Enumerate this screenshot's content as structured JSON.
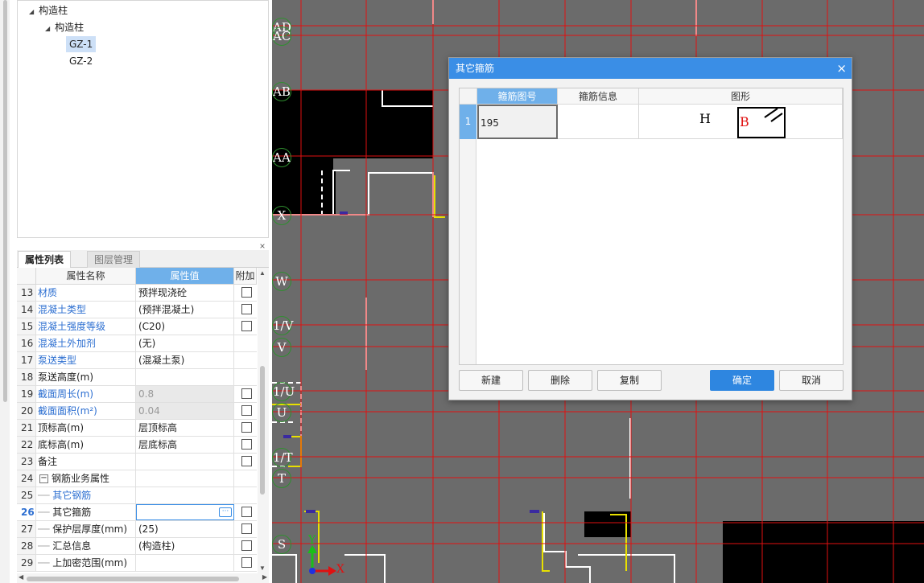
{
  "tree": {
    "root_label": "构造柱",
    "child_label": "构造柱",
    "items": [
      "GZ-1",
      "GZ-2"
    ],
    "selected": "GZ-1"
  },
  "panel": {
    "close_glyph": "×",
    "tabs": [
      "属性列表",
      "图层管理"
    ],
    "columns": [
      "属性名称",
      "属性值",
      "附加"
    ]
  },
  "properties": [
    {
      "num": "13",
      "name": "材质",
      "value": "预拌现浇砼",
      "blue": true,
      "check": true
    },
    {
      "num": "14",
      "name": "混凝土类型",
      "value": "(预拌混凝土)",
      "blue": true,
      "check": true
    },
    {
      "num": "15",
      "name": "混凝土强度等级",
      "value": "(C20)",
      "blue": true,
      "check": true
    },
    {
      "num": "16",
      "name": "混凝土外加剂",
      "value": "(无)",
      "blue": true,
      "check": false
    },
    {
      "num": "17",
      "name": "泵送类型",
      "value": "(混凝土泵)",
      "blue": true,
      "check": false
    },
    {
      "num": "18",
      "name": "泵送高度(m)",
      "value": "",
      "blue": false,
      "check": false
    },
    {
      "num": "19",
      "name": "截面周长(m)",
      "value": "0.8",
      "blue": true,
      "check": true,
      "grey": true
    },
    {
      "num": "20",
      "name": "截面面积(m²)",
      "value": "0.04",
      "blue": true,
      "check": true,
      "grey": true
    },
    {
      "num": "21",
      "name": "顶标高(m)",
      "value": "层顶标高",
      "blue": false,
      "check": true
    },
    {
      "num": "22",
      "name": "底标高(m)",
      "value": "层底标高",
      "blue": false,
      "check": true
    },
    {
      "num": "23",
      "name": "备注",
      "value": "",
      "blue": false,
      "check": true
    },
    {
      "num": "24",
      "name": "钢筋业务属性",
      "value": "",
      "blue": false,
      "check": false,
      "group": true
    },
    {
      "num": "25",
      "name": "其它钢筋",
      "value": "",
      "blue": true,
      "check": false,
      "indent": true
    },
    {
      "num": "26",
      "name": "其它箍筋",
      "value": "",
      "blue": false,
      "check": true,
      "indent": true,
      "selected": true,
      "editor": true
    },
    {
      "num": "27",
      "name": "保护层厚度(mm)",
      "value": "(25)",
      "blue": false,
      "check": true,
      "indent": true
    },
    {
      "num": "28",
      "name": "汇总信息",
      "value": "(构造柱)",
      "blue": false,
      "check": true,
      "indent": true
    },
    {
      "num": "29",
      "name": "上加密范围(mm)",
      "value": "",
      "blue": false,
      "check": true,
      "indent": true
    }
  ],
  "axes": {
    "labels": [
      "AD",
      "AC",
      "AB",
      "AA",
      "X",
      "W",
      "1/V",
      "V",
      "1/U",
      "U",
      "1/T",
      "T",
      "S"
    ],
    "ucs_x": "X",
    "ucs_y": "Y"
  },
  "dialog": {
    "title": "其它箍筋",
    "close_glyph": "×",
    "columns": [
      "箍筋图号",
      "箍筋信息",
      "图形"
    ],
    "rows": [
      {
        "num": "1",
        "code": "195",
        "info": "",
        "shape_h": "H",
        "shape_b": "B"
      }
    ],
    "buttons": {
      "new": "新建",
      "delete": "删除",
      "copy": "复制",
      "ok": "确定",
      "cancel": "取消"
    }
  }
}
